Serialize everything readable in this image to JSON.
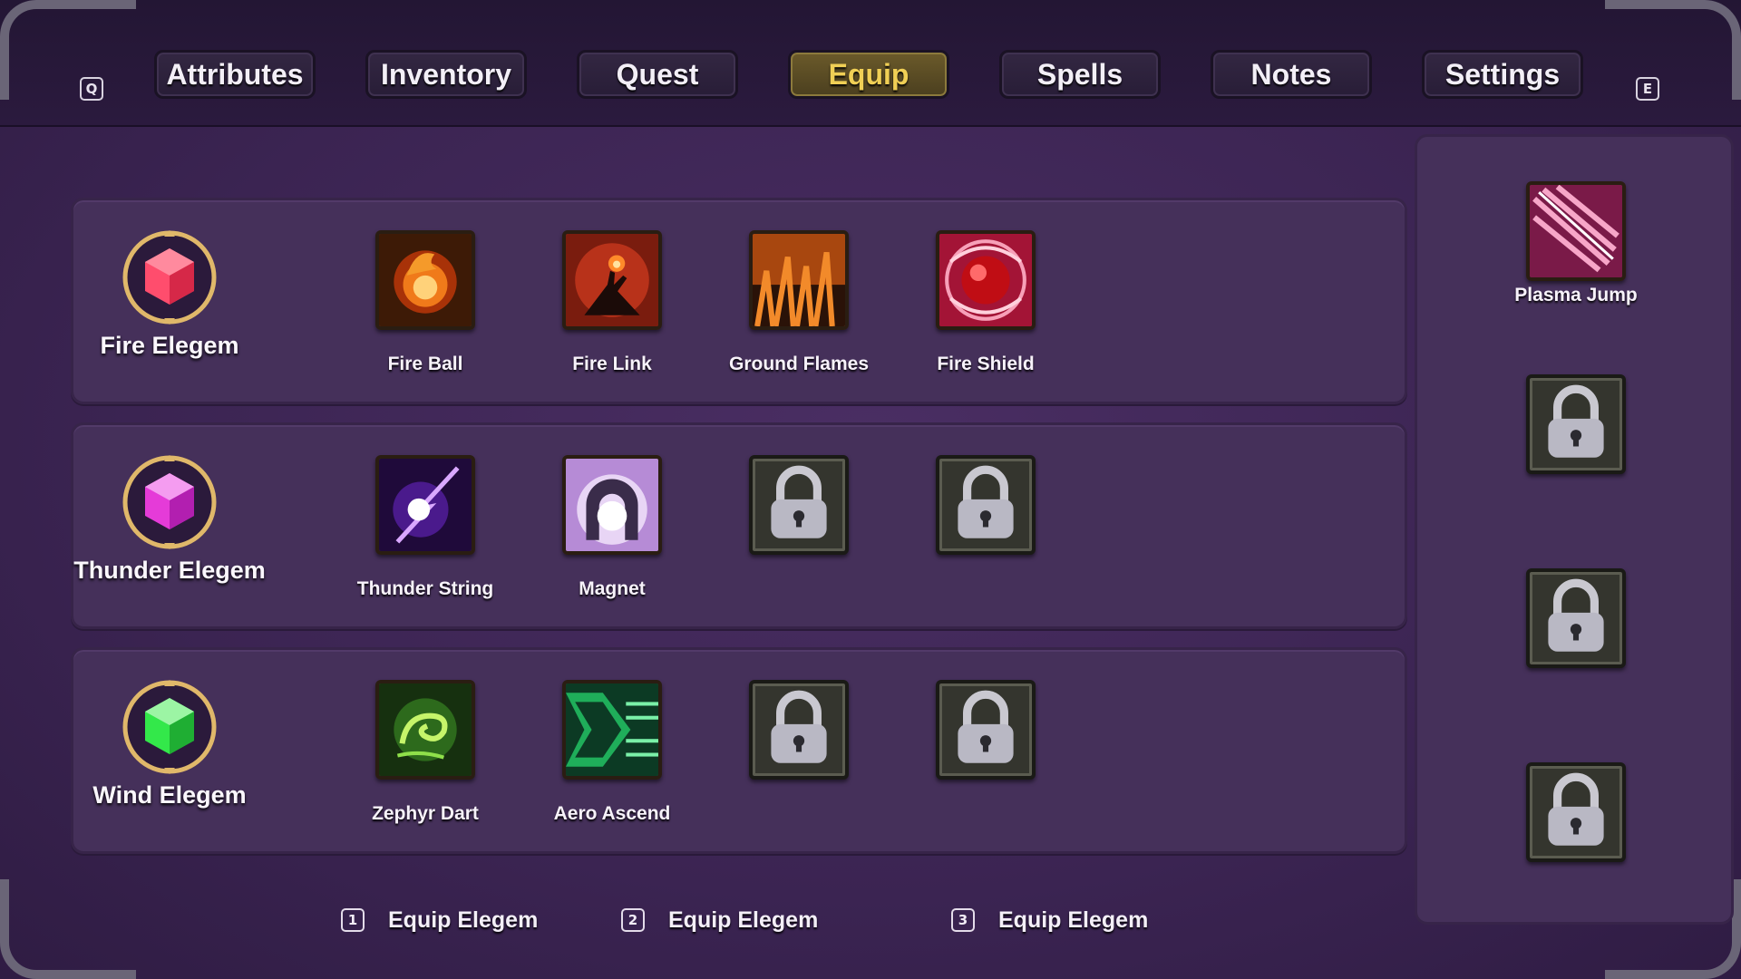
{
  "nav": {
    "prev_key": "Q",
    "next_key": "E",
    "tabs": [
      {
        "label": "Attributes",
        "active": false
      },
      {
        "label": "Inventory",
        "active": false
      },
      {
        "label": "Quest",
        "active": false
      },
      {
        "label": "Equip",
        "active": true
      },
      {
        "label": "Spells",
        "active": false
      },
      {
        "label": "Notes",
        "active": false
      },
      {
        "label": "Settings",
        "active": false
      }
    ],
    "active_color": "#f0cf55"
  },
  "elegems": [
    {
      "name": "Fire Elegem",
      "gem_color": "#ff4d6d",
      "gem_icon": "red-hexagon-gem-icon",
      "skills": [
        {
          "label": "Fire Ball",
          "icon": "fireball-icon",
          "locked": false
        },
        {
          "label": "Fire Link",
          "icon": "fire-link-hand-icon",
          "locked": false
        },
        {
          "label": "Ground Flames",
          "icon": "ground-flames-icon",
          "locked": false
        },
        {
          "label": "Fire Shield",
          "icon": "fire-shield-orb-icon",
          "locked": false
        }
      ]
    },
    {
      "name": "Thunder Elegem",
      "gem_color": "#e53bd8",
      "gem_icon": "purple-hexagon-gem-icon",
      "skills": [
        {
          "label": "Thunder String",
          "icon": "thunder-string-icon",
          "locked": false
        },
        {
          "label": "Magnet",
          "icon": "horseshoe-magnet-icon",
          "locked": false
        },
        {
          "label": "",
          "icon": "padlock-icon",
          "locked": true
        },
        {
          "label": "",
          "icon": "padlock-icon",
          "locked": true
        }
      ]
    },
    {
      "name": "Wind Elegem",
      "gem_color": "#33e84a",
      "gem_icon": "green-hexagon-gem-icon",
      "skills": [
        {
          "label": "Zephyr Dart",
          "icon": "zephyr-swirl-icon",
          "locked": false
        },
        {
          "label": "Aero Ascend",
          "icon": "aero-ascend-icon",
          "locked": false
        },
        {
          "label": "",
          "icon": "padlock-icon",
          "locked": true
        },
        {
          "label": "",
          "icon": "padlock-icon",
          "locked": true
        }
      ]
    }
  ],
  "side_slots": [
    {
      "label": "Plasma Jump",
      "icon": "plasma-jump-icon",
      "locked": false
    },
    {
      "label": "",
      "icon": "padlock-icon",
      "locked": true
    },
    {
      "label": "",
      "icon": "padlock-icon",
      "locked": true
    },
    {
      "label": "",
      "icon": "padlock-icon",
      "locked": true
    }
  ],
  "equip_hints": [
    {
      "key": "1",
      "label": "Equip Elegem"
    },
    {
      "key": "2",
      "label": "Equip Elegem"
    },
    {
      "key": "3",
      "label": "Equip Elegem"
    }
  ]
}
